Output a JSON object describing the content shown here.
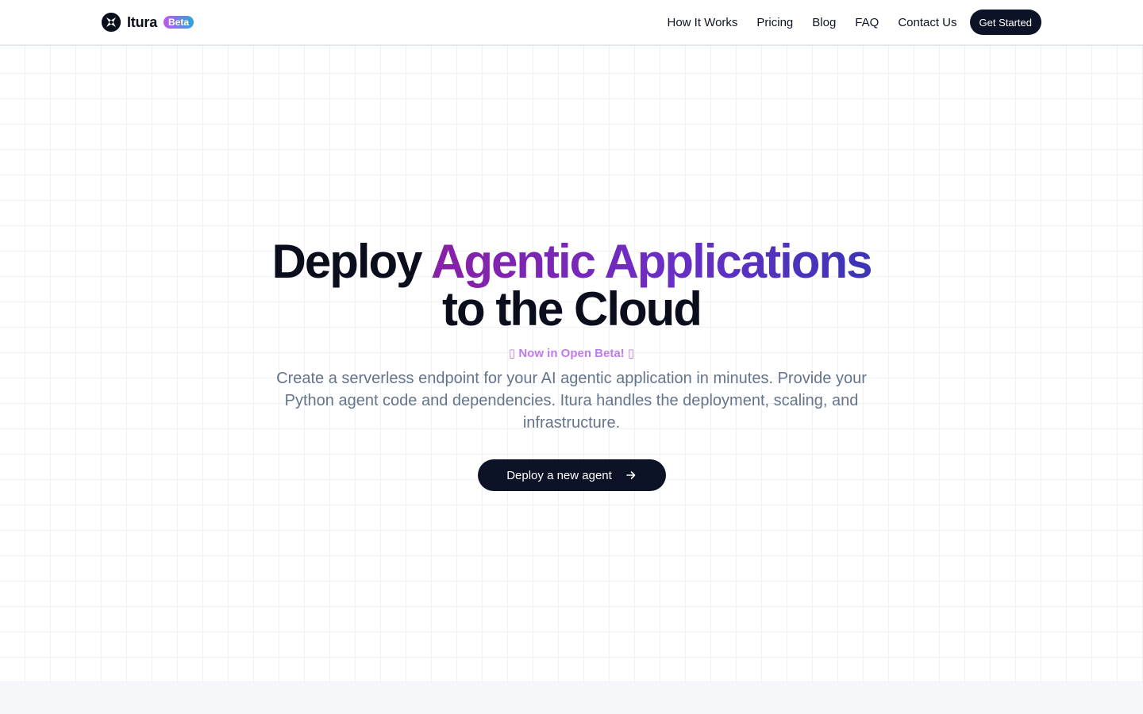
{
  "header": {
    "brand_name": "Itura",
    "badge": "Beta",
    "nav": [
      "How It Works",
      "Pricing",
      "Blog",
      "FAQ",
      "Contact Us"
    ],
    "cta": "Get Started"
  },
  "hero": {
    "title_part1": "Deploy ",
    "title_accent": "Agentic Applications",
    "title_line2": "to the Cloud",
    "beta_note": "▯ Now in Open Beta! ▯",
    "subtitle": "Create a serverless endpoint for your AI agentic application in minutes. Provide your Python agent code and dependencies. Itura handles the deployment, scaling, and infrastructure.",
    "cta": "Deploy a new agent"
  },
  "icons": {
    "logo": "itura-logo-icon",
    "cta_arrow": "arrow-right-icon"
  },
  "colors": {
    "dark": "#0d1326",
    "accent_start": "#8a1fa6",
    "accent_end": "#3b35b5",
    "beta_note": "#c07bea",
    "subtitle": "#64748b"
  }
}
